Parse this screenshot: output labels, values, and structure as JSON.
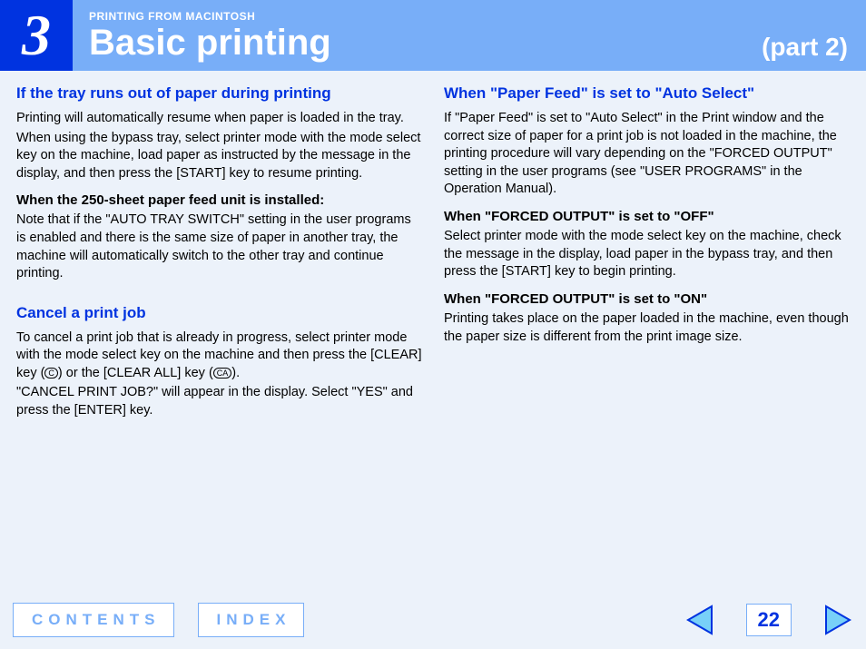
{
  "header": {
    "chapter_number": "3",
    "breadcrumb": "PRINTING FROM MACINTOSH",
    "title": "Basic printing",
    "part": "(part 2)"
  },
  "left": {
    "h1": "If the tray runs out of paper during printing",
    "p1": "Printing will automatically resume when paper is loaded in the tray.",
    "p2": "When using the bypass tray, select printer mode with the mode select key on the machine, load paper as instructed by the message in the display, and then press the [START] key to resume printing.",
    "h2": "When the 250-sheet paper feed unit is installed:",
    "p3": "Note that if the \"AUTO TRAY SWITCH\" setting in the user programs is enabled and there is the same size of paper in another tray, the machine will automatically switch to the other tray and continue printing.",
    "h3": "Cancel a print job",
    "p4a": "To cancel a print job that is already in progress, select printer mode with the mode select key on the machine and then press the [CLEAR] key (",
    "key1": "C",
    "p4b": ") or the [CLEAR ALL] key (",
    "key2": "CA",
    "p4c": ").",
    "p5": "\"CANCEL PRINT JOB?\" will appear in the display. Select \"YES\" and press the [ENTER] key."
  },
  "right": {
    "h1": "When \"Paper Feed\" is set to \"Auto Select\"",
    "p1": "If \"Paper Feed\" is set to \"Auto Select\" in the Print window and the correct size of paper for a print job is not loaded in the machine, the printing procedure will vary depending on the \"FORCED OUTPUT\" setting in the user programs (see \"USER PROGRAMS\" in the Operation Manual).",
    "h2": "When \"FORCED OUTPUT\" is set to \"OFF\"",
    "p2": "Select printer mode with the mode select key on the machine, check the message in the display, load paper in the bypass tray, and then press the [START] key to begin printing.",
    "h3": "When \"FORCED OUTPUT\" is set to \"ON\"",
    "p3": "Printing takes place on the paper loaded in the machine, even though the paper size is different from the print image size."
  },
  "footer": {
    "contents": "CONTENTS",
    "index": "INDEX",
    "page": "22"
  }
}
